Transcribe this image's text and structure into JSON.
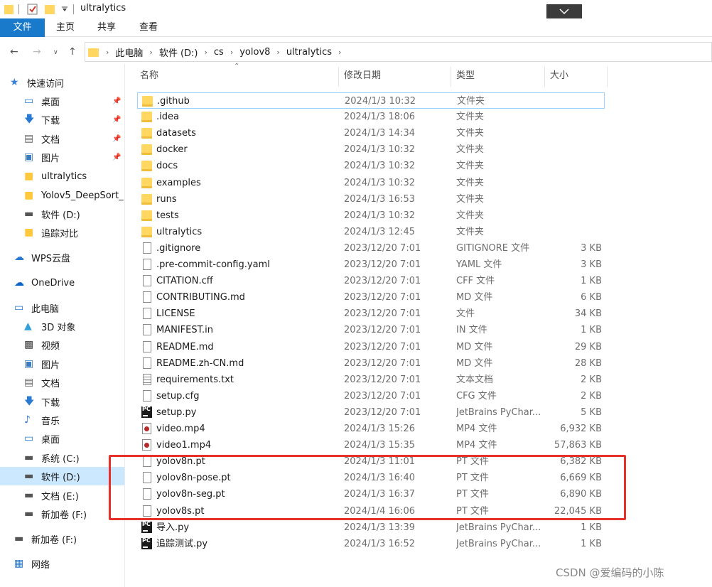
{
  "window": {
    "title": "ultralytics"
  },
  "ribbon": {
    "tabs": [
      "文件",
      "主页",
      "共享",
      "查看"
    ]
  },
  "breadcrumbs": [
    "此电脑",
    "软件 (D:)",
    "cs",
    "yolov8",
    "ultralytics"
  ],
  "columns": {
    "name": "名称",
    "date": "修改日期",
    "type": "类型",
    "size": "大小"
  },
  "sidebar": {
    "items": [
      {
        "label": "快速访问",
        "icon": "star-icon",
        "pinned": false
      },
      {
        "label": "桌面",
        "icon": "desktop-icon",
        "pinned": true
      },
      {
        "label": "下载",
        "icon": "download-icon",
        "pinned": true
      },
      {
        "label": "文档",
        "icon": "documents-icon",
        "pinned": true
      },
      {
        "label": "图片",
        "icon": "pictures-icon",
        "pinned": true
      },
      {
        "label": "ultralytics",
        "icon": "folder-icon",
        "pinned": false
      },
      {
        "label": "Yolov5_DeepSort_",
        "icon": "folder-icon",
        "pinned": false
      },
      {
        "label": "软件 (D:)",
        "icon": "drive-icon",
        "pinned": false
      },
      {
        "label": "追踪对比",
        "icon": "folder-icon",
        "pinned": false
      },
      {
        "label": "WPS云盘",
        "icon": "cloud-icon",
        "pinned": false
      },
      {
        "label": "OneDrive",
        "icon": "onedrive-icon",
        "pinned": false
      },
      {
        "label": "此电脑",
        "icon": "computer-icon",
        "pinned": false
      },
      {
        "label": "3D 对象",
        "icon": "3d-objects-icon",
        "pinned": false
      },
      {
        "label": "视频",
        "icon": "videos-icon",
        "pinned": false
      },
      {
        "label": "图片",
        "icon": "pictures-icon",
        "pinned": false
      },
      {
        "label": "文档",
        "icon": "documents-icon",
        "pinned": false
      },
      {
        "label": "下载",
        "icon": "download-icon",
        "pinned": false
      },
      {
        "label": "音乐",
        "icon": "music-icon",
        "pinned": false
      },
      {
        "label": "桌面",
        "icon": "desktop-icon",
        "pinned": false
      },
      {
        "label": "系统 (C:)",
        "icon": "drive-icon",
        "pinned": false
      },
      {
        "label": "软件 (D:)",
        "icon": "drive-icon",
        "pinned": false,
        "selected": true
      },
      {
        "label": "文档 (E:)",
        "icon": "drive-icon",
        "pinned": false
      },
      {
        "label": "新加卷 (F:)",
        "icon": "drive-icon",
        "pinned": false
      },
      {
        "label": "新加卷 (F:)",
        "icon": "drive-icon",
        "pinned": false
      },
      {
        "label": "网络",
        "icon": "network-icon",
        "pinned": false
      }
    ]
  },
  "files": [
    {
      "name": ".github",
      "date": "2024/1/3 10:32",
      "type": "文件夹",
      "size": "",
      "icon": "folder"
    },
    {
      "name": ".idea",
      "date": "2024/1/3 18:06",
      "type": "文件夹",
      "size": "",
      "icon": "folder"
    },
    {
      "name": "datasets",
      "date": "2024/1/3 14:34",
      "type": "文件夹",
      "size": "",
      "icon": "folder"
    },
    {
      "name": "docker",
      "date": "2024/1/3 10:32",
      "type": "文件夹",
      "size": "",
      "icon": "folder"
    },
    {
      "name": "docs",
      "date": "2024/1/3 10:32",
      "type": "文件夹",
      "size": "",
      "icon": "folder"
    },
    {
      "name": "examples",
      "date": "2024/1/3 10:32",
      "type": "文件夹",
      "size": "",
      "icon": "folder"
    },
    {
      "name": "runs",
      "date": "2024/1/3 16:53",
      "type": "文件夹",
      "size": "",
      "icon": "folder"
    },
    {
      "name": "tests",
      "date": "2024/1/3 10:32",
      "type": "文件夹",
      "size": "",
      "icon": "folder"
    },
    {
      "name": "ultralytics",
      "date": "2024/1/3 12:45",
      "type": "文件夹",
      "size": "",
      "icon": "folder"
    },
    {
      "name": ".gitignore",
      "date": "2023/12/20 7:01",
      "type": "GITIGNORE 文件",
      "size": "3 KB",
      "icon": "file"
    },
    {
      "name": ".pre-commit-config.yaml",
      "date": "2023/12/20 7:01",
      "type": "YAML 文件",
      "size": "3 KB",
      "icon": "file"
    },
    {
      "name": "CITATION.cff",
      "date": "2023/12/20 7:01",
      "type": "CFF 文件",
      "size": "1 KB",
      "icon": "file"
    },
    {
      "name": "CONTRIBUTING.md",
      "date": "2023/12/20 7:01",
      "type": "MD 文件",
      "size": "6 KB",
      "icon": "file"
    },
    {
      "name": "LICENSE",
      "date": "2023/12/20 7:01",
      "type": "文件",
      "size": "34 KB",
      "icon": "file"
    },
    {
      "name": "MANIFEST.in",
      "date": "2023/12/20 7:01",
      "type": "IN 文件",
      "size": "1 KB",
      "icon": "file"
    },
    {
      "name": "README.md",
      "date": "2023/12/20 7:01",
      "type": "MD 文件",
      "size": "29 KB",
      "icon": "file"
    },
    {
      "name": "README.zh-CN.md",
      "date": "2023/12/20 7:01",
      "type": "MD 文件",
      "size": "28 KB",
      "icon": "file"
    },
    {
      "name": "requirements.txt",
      "date": "2023/12/20 7:01",
      "type": "文本文档",
      "size": "2 KB",
      "icon": "txt"
    },
    {
      "name": "setup.cfg",
      "date": "2023/12/20 7:01",
      "type": "CFG 文件",
      "size": "2 KB",
      "icon": "file"
    },
    {
      "name": "setup.py",
      "date": "2023/12/20 7:01",
      "type": "JetBrains PyChar...",
      "size": "5 KB",
      "icon": "pycharm"
    },
    {
      "name": "video.mp4",
      "date": "2024/1/3 15:26",
      "type": "MP4 文件",
      "size": "6,932 KB",
      "icon": "video"
    },
    {
      "name": "video1.mp4",
      "date": "2024/1/3 15:35",
      "type": "MP4 文件",
      "size": "57,863 KB",
      "icon": "video"
    },
    {
      "name": "yolov8n.pt",
      "date": "2024/1/3 11:01",
      "type": "PT 文件",
      "size": "6,382 KB",
      "icon": "file"
    },
    {
      "name": "yolov8n-pose.pt",
      "date": "2024/1/3 16:40",
      "type": "PT 文件",
      "size": "6,669 KB",
      "icon": "file"
    },
    {
      "name": "yolov8n-seg.pt",
      "date": "2024/1/3 16:37",
      "type": "PT 文件",
      "size": "6,890 KB",
      "icon": "file"
    },
    {
      "name": "yolov8s.pt",
      "date": "2024/1/4 16:06",
      "type": "PT 文件",
      "size": "22,045 KB",
      "icon": "file"
    },
    {
      "name": "导入.py",
      "date": "2024/1/3 13:39",
      "type": "JetBrains PyChar...",
      "size": "1 KB",
      "icon": "pycharm"
    },
    {
      "name": "追踪测试.py",
      "date": "2024/1/3 16:52",
      "type": "JetBrains PyChar...",
      "size": "1 KB",
      "icon": "pycharm"
    }
  ],
  "pycharm_icon_text": "PC",
  "watermark": "CSDN @爱编码的小陈",
  "colors": {
    "accent": "#1979ca",
    "selection": "#cce8ff",
    "highlight_box": "#e8302a",
    "folder": "#ffd761"
  }
}
